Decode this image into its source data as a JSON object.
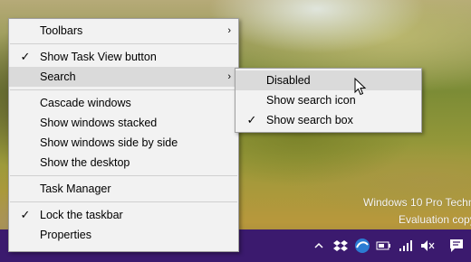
{
  "desktop": {
    "watermark_line1": "Windows 10 Pro Techn",
    "watermark_line2": "Evaluation copy"
  },
  "context_menu": {
    "items": [
      {
        "label": "Toolbars",
        "checked": false,
        "has_submenu": true
      },
      {
        "label": "Show Task View button",
        "checked": true,
        "has_submenu": false
      },
      {
        "label": "Search",
        "checked": false,
        "has_submenu": true,
        "highlighted": true
      },
      {
        "label": "Cascade windows",
        "checked": false
      },
      {
        "label": "Show windows stacked",
        "checked": false
      },
      {
        "label": "Show windows side by side",
        "checked": false
      },
      {
        "label": "Show the desktop",
        "checked": false
      },
      {
        "label": "Task Manager",
        "checked": false
      },
      {
        "label": "Lock the taskbar",
        "checked": true
      },
      {
        "label": "Properties",
        "checked": false
      }
    ],
    "check_glyph": "✓",
    "submenu_arrow": "›"
  },
  "search_submenu": {
    "items": [
      {
        "label": "Disabled",
        "checked": false,
        "highlighted": true
      },
      {
        "label": "Show search icon",
        "checked": false
      },
      {
        "label": "Show search box",
        "checked": true
      }
    ]
  },
  "taskbar": {
    "color": "#3b1a6e",
    "tray_icons": [
      "show-hidden-icons-chevron",
      "dropbox-icon",
      "browser-icon",
      "battery-icon",
      "network-icon",
      "volume-muted-icon",
      "action-center-icon"
    ]
  }
}
